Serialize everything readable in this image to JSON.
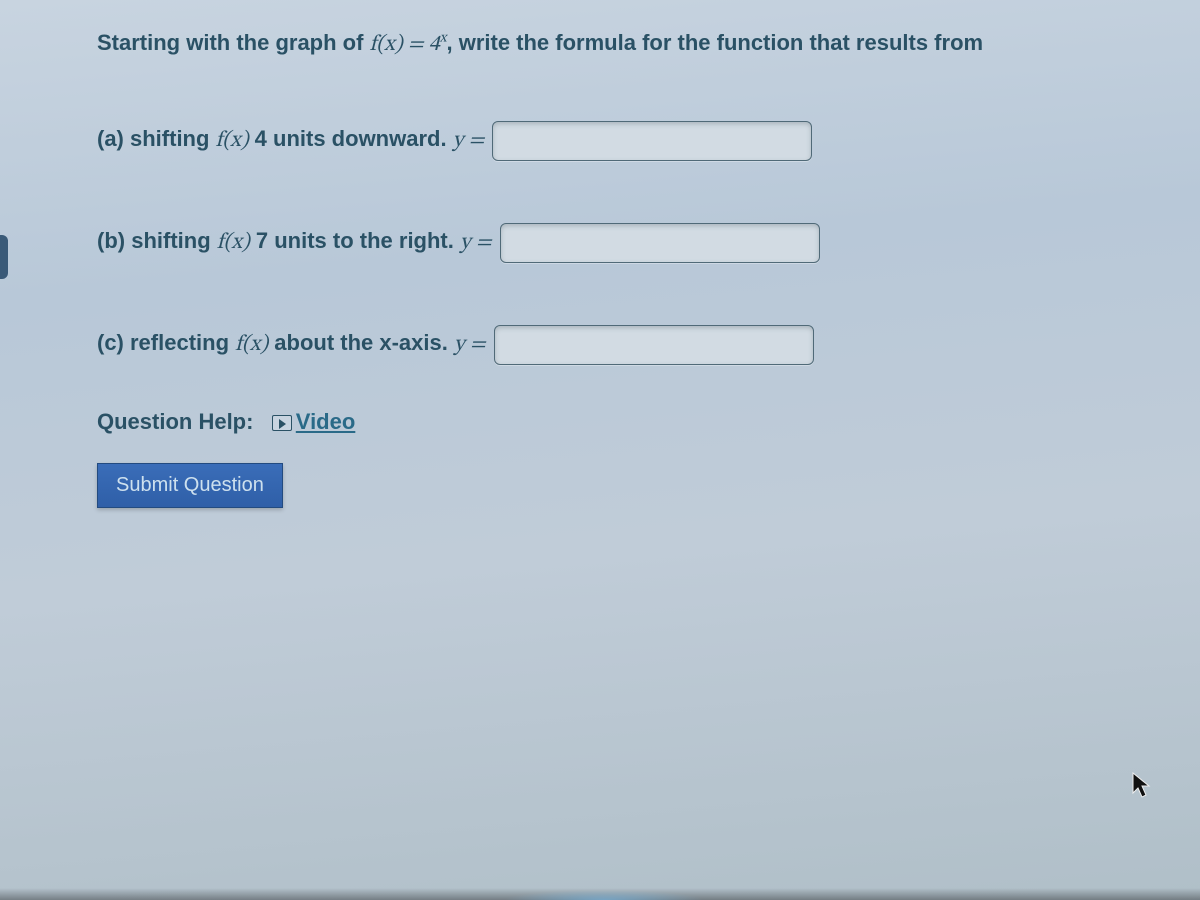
{
  "intro": {
    "prefix": "Starting with the graph of ",
    "func": "f(x) = 4",
    "exp": "x",
    "suffix": ", write the formula for the function that results from"
  },
  "parts": {
    "a": {
      "label": "(a) shifting ",
      "fx": "f(x)",
      "rest": " 4 units downward. ",
      "y": "y ="
    },
    "b": {
      "label": "(b) shifting ",
      "fx": "f(x)",
      "rest": " 7 units to the right. ",
      "y": "y ="
    },
    "c": {
      "label": "(c) reflecting ",
      "fx": "f(x)",
      "rest": " about the x-axis. ",
      "y": "y ="
    }
  },
  "help": {
    "label": "Question Help:",
    "video": "Video"
  },
  "submit": "Submit Question"
}
